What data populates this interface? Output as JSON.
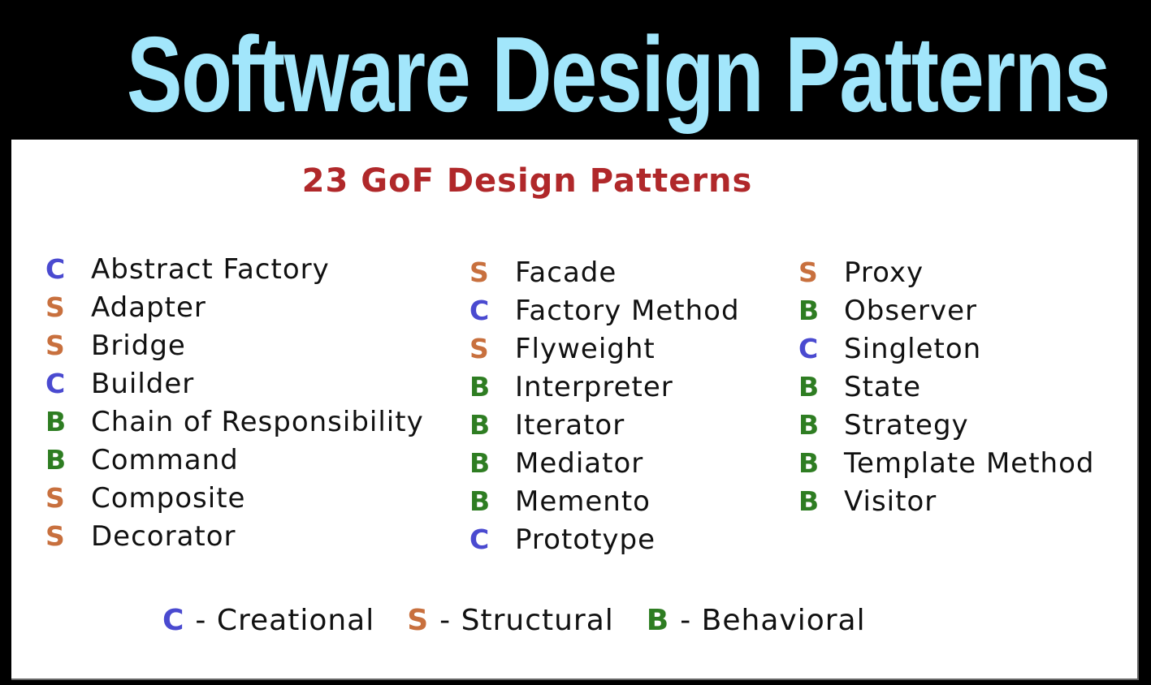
{
  "header": {
    "title": "Software Design Patterns"
  },
  "panel": {
    "subtitle": "23 GoF Design Patterns",
    "columns": [
      [
        {
          "type": "C",
          "name": "Abstract Factory"
        },
        {
          "type": "S",
          "name": "Adapter"
        },
        {
          "type": "S",
          "name": "Bridge"
        },
        {
          "type": "C",
          "name": "Builder"
        },
        {
          "type": "B",
          "name": "Chain of Responsibility"
        },
        {
          "type": "B",
          "name": "Command"
        },
        {
          "type": "S",
          "name": "Composite"
        },
        {
          "type": "S",
          "name": "Decorator"
        }
      ],
      [
        {
          "type": "S",
          "name": "Facade"
        },
        {
          "type": "C",
          "name": "Factory Method"
        },
        {
          "type": "S",
          "name": "Flyweight"
        },
        {
          "type": "B",
          "name": "Interpreter"
        },
        {
          "type": "B",
          "name": "Iterator"
        },
        {
          "type": "B",
          "name": "Mediator"
        },
        {
          "type": "B",
          "name": "Memento"
        },
        {
          "type": "C",
          "name": "Prototype"
        }
      ],
      [
        {
          "type": "S",
          "name": "Proxy"
        },
        {
          "type": "B",
          "name": "Observer"
        },
        {
          "type": "C",
          "name": "Singleton"
        },
        {
          "type": "B",
          "name": "State"
        },
        {
          "type": "B",
          "name": "Strategy"
        },
        {
          "type": "B",
          "name": "Template Method"
        },
        {
          "type": "B",
          "name": "Visitor"
        }
      ]
    ],
    "legend": [
      {
        "type": "C",
        "text": "- Creational"
      },
      {
        "type": "S",
        "text": "- Structural"
      },
      {
        "type": "B",
        "text": "- Behavioral"
      }
    ]
  },
  "colors": {
    "title": "#a2e6fb",
    "subtitle": "#b0282a",
    "creational": "#4a4ad0",
    "structural": "#c8703e",
    "behavioral": "#2e7d22"
  }
}
